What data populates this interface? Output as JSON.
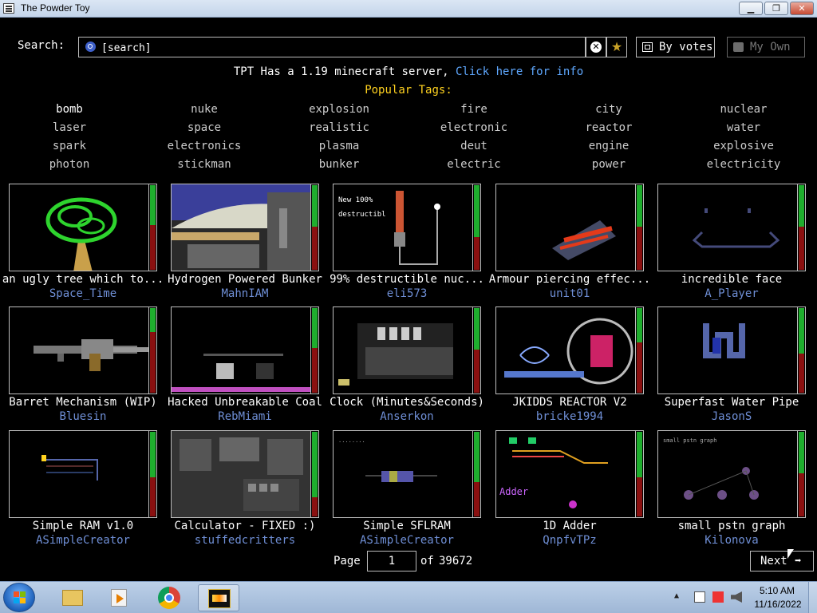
{
  "window": {
    "title": "The Powder Toy"
  },
  "search": {
    "label": "Search:",
    "placeholder": "[search]",
    "value": ""
  },
  "toolbar": {
    "sort_label": "By votes",
    "myown_label": "My Own"
  },
  "announcement": {
    "text": "TPT Has a 1.19 minecraft server, ",
    "link": "Click here for info"
  },
  "tags": {
    "title": "Popular Tags:",
    "items": [
      "bomb",
      "nuke",
      "explosion",
      "fire",
      "city",
      "nuclear",
      "laser",
      "space",
      "realistic",
      "electronic",
      "reactor",
      "water",
      "spark",
      "electronics",
      "plasma",
      "deut",
      "engine",
      "explosive",
      "photon",
      "stickman",
      "bunker",
      "electric",
      "power",
      "electricity"
    ]
  },
  "saves": [
    {
      "title": "an ugly tree which to...",
      "author": "Space_Time",
      "votes_up": 0.48
    },
    {
      "title": "Hydrogen Powered Bunker",
      "author": "MahnIAM",
      "votes_up": 0.5
    },
    {
      "title": "99% destructible nuc...",
      "author": "eli573",
      "votes_up": 0.62
    },
    {
      "title": "Armour piercing effec...",
      "author": "unit01",
      "votes_up": 0.5
    },
    {
      "title": "incredible face",
      "author": "A_Player",
      "votes_up": 0.5
    },
    {
      "title": "Barret Mechanism (WIP)",
      "author": "Bluesin",
      "votes_up": 0.3
    },
    {
      "title": "Hacked Unbreakable Coal",
      "author": "RebMiami",
      "votes_up": 0.48
    },
    {
      "title": "Clock (Minutes&Seconds)",
      "author": "Anserkon",
      "votes_up": 0.5
    },
    {
      "title": "JKIDDS REACTOR V2",
      "author": "bricke1994",
      "votes_up": 0.42
    },
    {
      "title": "Superfast Water Pipe",
      "author": "JasonS",
      "votes_up": 0.55
    },
    {
      "title": "Simple RAM v1.0",
      "author": "ASimpleCreator",
      "votes_up": 0.55
    },
    {
      "title": "Calculator - FIXED :)",
      "author": "stuffedcritters",
      "votes_up": 0.78
    },
    {
      "title": "Simple SFLRAM",
      "author": "ASimpleCreator",
      "votes_up": 0.6
    },
    {
      "title": "1D Adder",
      "author": "QnpfvTPz",
      "votes_up": 0.55
    },
    {
      "title": "small pstn graph",
      "author": "Kilonova",
      "votes_up": 0.5
    }
  ],
  "pagination": {
    "page_label": "Page",
    "current": "1",
    "of_label": "of",
    "total": "39672",
    "next_label": "Next"
  },
  "taskbar": {
    "time": "5:10 AM",
    "date": "11/16/2022"
  },
  "colors": {
    "vote_up": "#1fae2e",
    "vote_down": "#8a1010",
    "author": "#6f8fd6",
    "tags_title": "#ffd21f",
    "link": "#5fa8ff"
  }
}
